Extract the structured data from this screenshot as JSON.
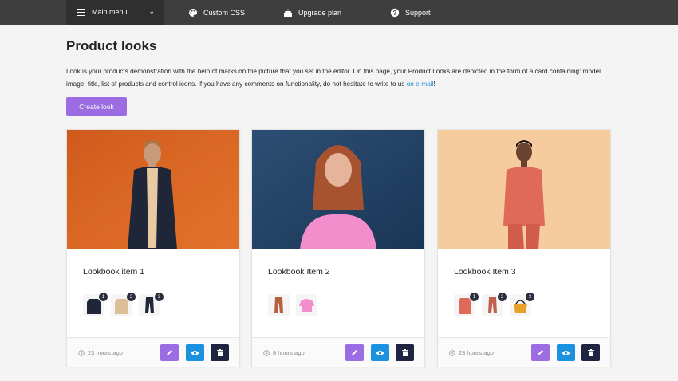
{
  "nav": {
    "menu_label": "Main menu",
    "items": [
      {
        "label": "Custom CSS",
        "icon": "palette-icon"
      },
      {
        "label": "Upgrade plan",
        "icon": "cake-icon"
      },
      {
        "label": "Support",
        "icon": "help-icon"
      }
    ]
  },
  "page": {
    "title": "Product looks",
    "intro_text": "Look is your products demonstration with the help of marks on the picture that you set in the editor. On this page, your Product Looks are depicted in the form of a card containing: model image, title, list of products and control icons. If you have any comments on functionality, do not hesitate to write to us ",
    "intro_link": "on e-mail",
    "intro_end": "!",
    "create_button": "Create look"
  },
  "colors": {
    "accent_purple": "#9b6ce2",
    "accent_blue": "#1b92e0",
    "dark_navy": "#1f2440",
    "nav_bg": "#3e3e3e"
  },
  "cards": [
    {
      "title": "Lookbook item 1",
      "time": "23 hours ago",
      "products": [
        "1",
        "2",
        "3"
      ]
    },
    {
      "title": "Lookbook Item 2",
      "time": "8 hours ago",
      "products": []
    },
    {
      "title": "Lookbook Item 3",
      "time": "23 hours ago",
      "products": [
        "1",
        "2",
        "3"
      ]
    }
  ]
}
